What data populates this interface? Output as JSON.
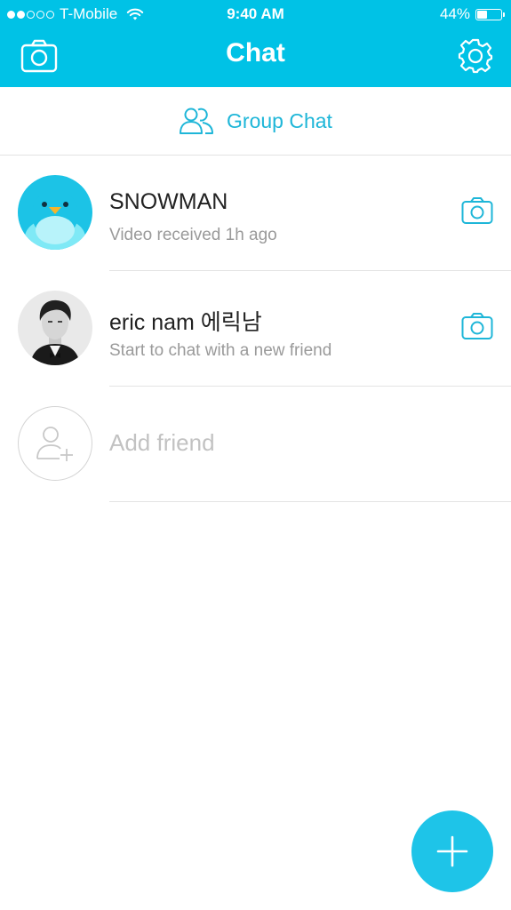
{
  "colors": {
    "brand": "#00c2e6",
    "accent_text": "#1eb6d8",
    "fab": "#1ec4e8",
    "divider": "#e3e3e3"
  },
  "status_bar": {
    "carrier": "T-Mobile",
    "signal_bars_filled": 2,
    "signal_bars_total": 5,
    "time": "9:40 AM",
    "battery_percent_label": "44%",
    "battery_level": 0.44
  },
  "nav": {
    "title": "Chat",
    "left_icon": "camera-icon",
    "right_icon": "gear-icon"
  },
  "group_chat": {
    "icon": "group-users-icon",
    "label": "Group Chat"
  },
  "chats": [
    {
      "name": "SNOWMAN",
      "subtitle": "Video received 1h ago",
      "avatar": "penguin-avatar",
      "action_icon": "camera-icon"
    },
    {
      "name": "eric nam 에릭남",
      "subtitle": "Start to chat with a new friend",
      "avatar": "person-photo-avatar",
      "action_icon": "camera-icon"
    }
  ],
  "add_friend": {
    "icon": "add-user-icon",
    "label": "Add friend"
  },
  "fab": {
    "icon": "plus-icon"
  }
}
